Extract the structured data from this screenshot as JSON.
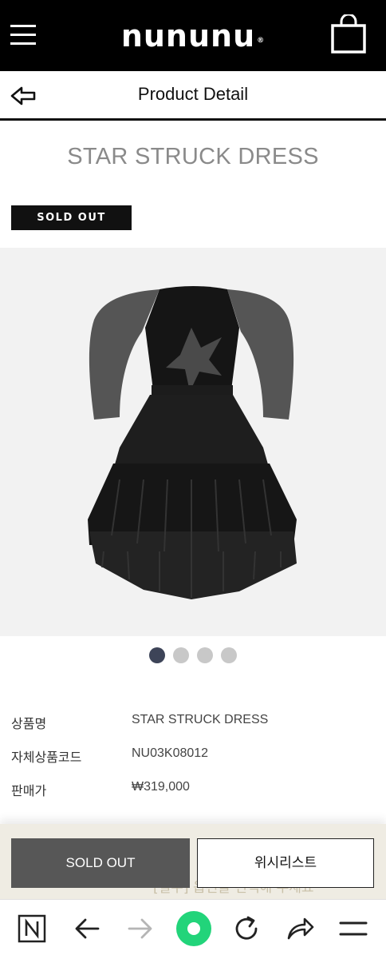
{
  "header": {
    "logo": "nununu",
    "logo_mark": "®",
    "menu_icon": "hamburger-icon",
    "bag_icon": "shopping-bag-icon"
  },
  "subheader": {
    "title": "Product Detail",
    "back_icon": "back-arrow-icon"
  },
  "product": {
    "title": "STAR STRUCK DRESS",
    "status_badge": "SOLD OUT",
    "carousel": {
      "total": 4,
      "active": 1
    }
  },
  "details": [
    {
      "label": "상품명",
      "value": "STAR STRUCK DRESS"
    },
    {
      "label": "자체상품코드",
      "value": "NU03K08012"
    },
    {
      "label": "판매가",
      "value": "₩319,000"
    }
  ],
  "actions": {
    "soldout_label": "SOLD OUT",
    "wishlist_label": "위시리스트",
    "obscured_text": "[필수] 옵션을 선택해 주세요"
  },
  "browser_nav": {
    "icons": [
      "naver-n-icon",
      "back-icon",
      "forward-icon",
      "home-green-icon",
      "refresh-icon",
      "share-icon",
      "menu-icon"
    ]
  },
  "colors": {
    "header_bg": "#000000",
    "badge_bg": "#111111",
    "soldout_button": "#575757",
    "dot_active": "#3d4458",
    "dot_inactive": "#c8c8c8",
    "green_accent": "#22d47a"
  }
}
